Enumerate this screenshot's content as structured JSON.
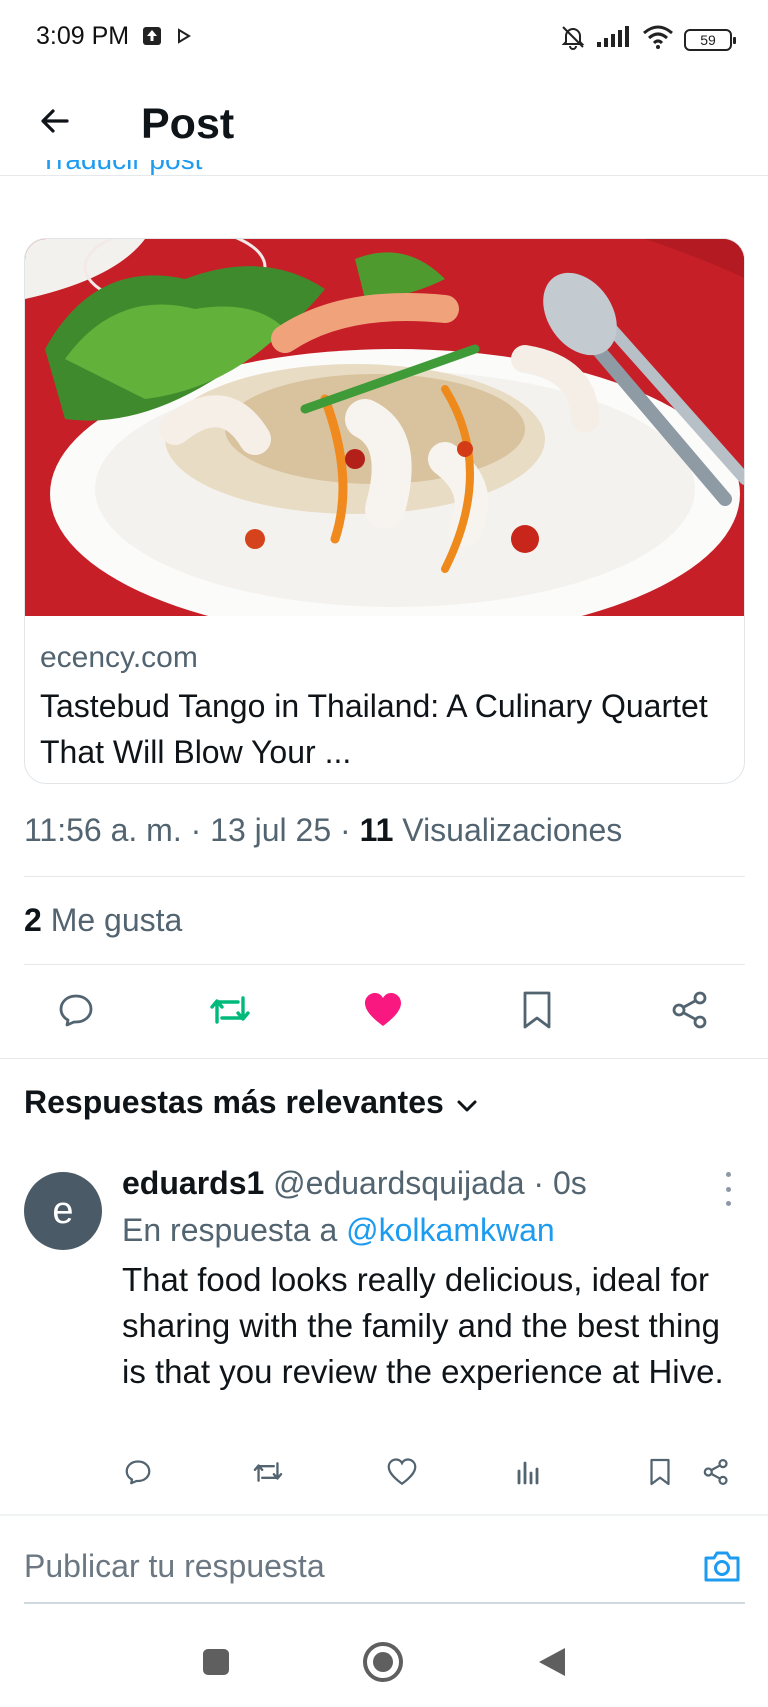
{
  "status_bar": {
    "time": "3:09 PM",
    "battery": "59",
    "icons": [
      "upload-icon",
      "play-icon",
      "mute-icon",
      "signal-icon",
      "wifi-icon",
      "battery-icon"
    ]
  },
  "header": {
    "title": "Post",
    "back_icon": "arrow-left-icon",
    "clipped_text": "Traducir post"
  },
  "link_card": {
    "domain": "ecency.com",
    "title": "Tastebud Tango in Thailand: A Culinary Quartet That Will Blow Your ..."
  },
  "post_meta": {
    "time": "11:56 a. m. · 13 jul 25 · ",
    "views_count": "11",
    "views_label": " Visualizaciones"
  },
  "likes": {
    "count": "2",
    "label": " Me gusta"
  },
  "actions": [
    {
      "icon": "reply-icon",
      "color": "#536471"
    },
    {
      "icon": "repost-icon",
      "color": "#00ba7c"
    },
    {
      "icon": "heart-filled-icon",
      "color": "#f91880"
    },
    {
      "icon": "bookmark-icon",
      "color": "#536471"
    },
    {
      "icon": "share-icon",
      "color": "#536471"
    }
  ],
  "replies_section": {
    "title": "Respuestas más relevantes"
  },
  "reply": {
    "avatar_letter": "e",
    "name": "eduards1",
    "handle": " @eduardsquijada · 0s",
    "reply_to_prefix": "En respuesta a ",
    "reply_to_user": "@kolkamkwan",
    "text": "That food looks really delicious, ideal for sharing with the family and the best thing is that you review the experience at Hive."
  },
  "compose": {
    "placeholder": "Publicar tu respuesta"
  },
  "colors": {
    "accent": "#1d9bf0",
    "secondary_text": "#536471",
    "like": "#f91880",
    "repost": "#00ba7c"
  }
}
